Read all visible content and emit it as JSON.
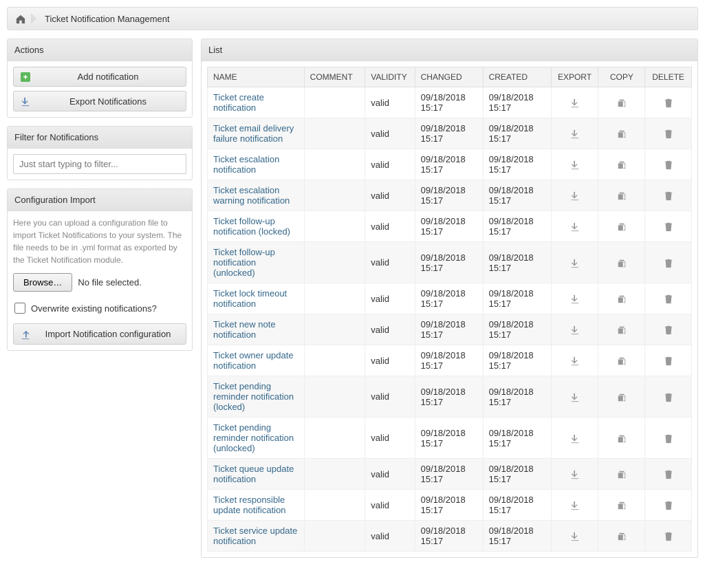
{
  "breadcrumb": {
    "title": "Ticket Notification Management"
  },
  "sidebar": {
    "actions": {
      "header": "Actions",
      "add_label": "Add notification",
      "export_label": "Export Notifications"
    },
    "filter": {
      "header": "Filter for Notifications",
      "placeholder": "Just start typing to filter..."
    },
    "config": {
      "header": "Configuration Import",
      "desc": "Here you can upload a configuration file to import Ticket Notifications to your system. The file needs to be in .yml format as exported by the Ticket Notification module.",
      "browse_label": "Browse…",
      "file_status": "No file selected.",
      "overwrite_label": "Overwrite existing notifications?",
      "import_label": "Import Notification configuration"
    }
  },
  "list": {
    "header": "List",
    "columns": {
      "name": "NAME",
      "comment": "COMMENT",
      "validity": "VALIDITY",
      "changed": "CHANGED",
      "created": "CREATED",
      "export": "EXPORT",
      "copy": "COPY",
      "delete": "DELETE"
    },
    "rows": [
      {
        "name": "Ticket create notification",
        "comment": "",
        "validity": "valid",
        "changed": "09/18/2018 15:17",
        "created": "09/18/2018 15:17"
      },
      {
        "name": "Ticket email delivery failure notification",
        "comment": "",
        "validity": "valid",
        "changed": "09/18/2018 15:17",
        "created": "09/18/2018 15:17"
      },
      {
        "name": "Ticket escalation notification",
        "comment": "",
        "validity": "valid",
        "changed": "09/18/2018 15:17",
        "created": "09/18/2018 15:17"
      },
      {
        "name": "Ticket escalation warning notification",
        "comment": "",
        "validity": "valid",
        "changed": "09/18/2018 15:17",
        "created": "09/18/2018 15:17"
      },
      {
        "name": "Ticket follow-up notification (locked)",
        "comment": "",
        "validity": "valid",
        "changed": "09/18/2018 15:17",
        "created": "09/18/2018 15:17"
      },
      {
        "name": "Ticket follow-up notification (unlocked)",
        "comment": "",
        "validity": "valid",
        "changed": "09/18/2018 15:17",
        "created": "09/18/2018 15:17"
      },
      {
        "name": "Ticket lock timeout notification",
        "comment": "",
        "validity": "valid",
        "changed": "09/18/2018 15:17",
        "created": "09/18/2018 15:17"
      },
      {
        "name": "Ticket new note notification",
        "comment": "",
        "validity": "valid",
        "changed": "09/18/2018 15:17",
        "created": "09/18/2018 15:17"
      },
      {
        "name": "Ticket owner update notification",
        "comment": "",
        "validity": "valid",
        "changed": "09/18/2018 15:17",
        "created": "09/18/2018 15:17"
      },
      {
        "name": "Ticket pending reminder notification (locked)",
        "comment": "",
        "validity": "valid",
        "changed": "09/18/2018 15:17",
        "created": "09/18/2018 15:17"
      },
      {
        "name": "Ticket pending reminder notification (unlocked)",
        "comment": "",
        "validity": "valid",
        "changed": "09/18/2018 15:17",
        "created": "09/18/2018 15:17"
      },
      {
        "name": "Ticket queue update notification",
        "comment": "",
        "validity": "valid",
        "changed": "09/18/2018 15:17",
        "created": "09/18/2018 15:17"
      },
      {
        "name": "Ticket responsible update notification",
        "comment": "",
        "validity": "valid",
        "changed": "09/18/2018 15:17",
        "created": "09/18/2018 15:17"
      },
      {
        "name": "Ticket service update notification",
        "comment": "",
        "validity": "valid",
        "changed": "09/18/2018 15:17",
        "created": "09/18/2018 15:17"
      }
    ]
  }
}
